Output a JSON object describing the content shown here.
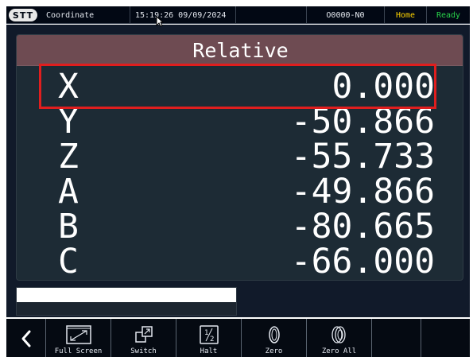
{
  "topbar": {
    "logo": "STT",
    "title": "Coordinate",
    "clock": "15:19:26 09/09/2024",
    "program": "O0000-N0",
    "mode": "Home",
    "status": "Ready"
  },
  "panel": {
    "header": "Relative",
    "axes": [
      {
        "label": "X",
        "value": "0.000"
      },
      {
        "label": "Y",
        "value": "-50.866"
      },
      {
        "label": "Z",
        "value": "-55.733"
      },
      {
        "label": "A",
        "value": "-49.866"
      },
      {
        "label": "B",
        "value": "-80.665"
      },
      {
        "label": "C",
        "value": "-66.000"
      }
    ]
  },
  "input": {
    "value": ""
  },
  "toolbar": {
    "full_screen": "Full Screen",
    "switch": "Switch",
    "halt": "Halt",
    "halt_icon_text": "1/2",
    "zero": "Zero",
    "zero_all": "Zero All"
  },
  "colors": {
    "mode": "#ffd400",
    "status": "#28d34a",
    "header_bg": "#6e4b52",
    "highlight": "#e01e1e",
    "panel_bg": "#1d2b35"
  },
  "icons": {
    "back": "chevron-left-icon",
    "full_screen": "full-screen-icon",
    "switch": "switch-windows-icon",
    "halt": "half-fraction-icon",
    "zero": "zero-icon",
    "zero_all": "zero-all-icon"
  }
}
